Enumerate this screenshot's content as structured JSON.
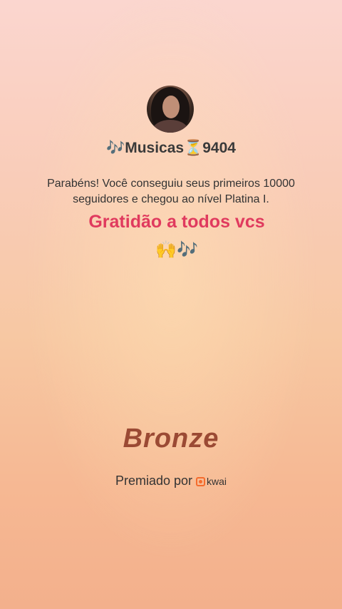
{
  "profile": {
    "name": "🎶Musicas⏳9404"
  },
  "message": "Parabéns! Você conseguiu seus primeiros 10000 seguidores e chegou ao nível Platina I.",
  "gratitude": "Gratidão a todos vcs",
  "emojis": "🙌🎶",
  "level": "Bronze",
  "premiado_label": "Premiado por",
  "brand": "kwai",
  "icons": {
    "brand_icon": "kwai-logo-icon"
  },
  "colors": {
    "gratitude": "#e03a5e",
    "level": "#9b4a34",
    "brand": "#f56c2d"
  }
}
